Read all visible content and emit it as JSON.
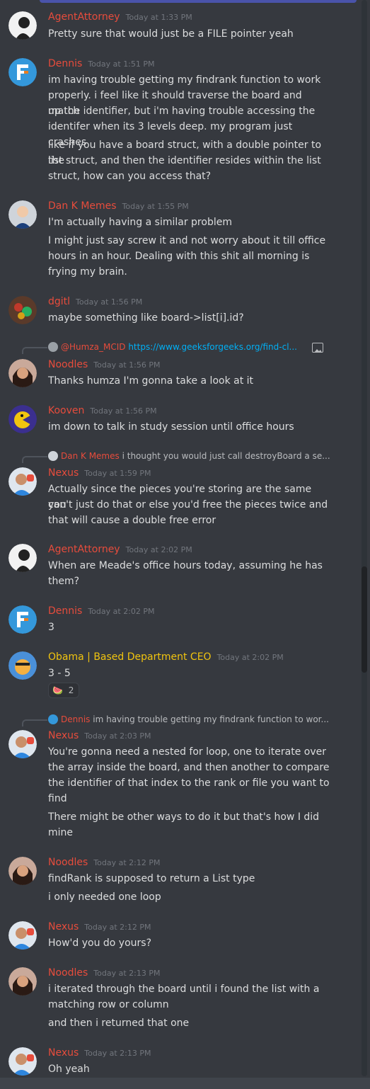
{
  "messages": [
    {
      "author": "AgentAttorney",
      "time": "Today at 1:33 PM",
      "lines": [
        "Pretty sure that would just be a FILE pointer yeah"
      ]
    },
    {
      "author": "Dennis",
      "time": "Today at 1:51 PM",
      "lines": [
        "im having trouble getting my findrank function to work",
        "properly. i feel like it should traverse the board and match",
        "up the identifier, but i'm having trouble accessing the",
        "identifer when its 3 levels deep. my program just crashes",
        "like if you have a board struct, with a double pointer to the",
        "list struct, and then the identifier resides within the list",
        "struct, how can you access that?"
      ]
    },
    {
      "author": "Dan K Memes",
      "time": "Today at 1:55 PM",
      "lines": [
        "I'm actually having a similar problem",
        "I might just say screw it and not worry about it till office",
        "hours in an hour. Dealing with this shit all morning is",
        "frying my brain."
      ]
    },
    {
      "author": "dgitl",
      "time": "Today at 1:56 PM",
      "lines": [
        "maybe something like board->list[i].id?"
      ]
    },
    {
      "author": "Noodles",
      "time": "Today at 1:56 PM",
      "reply_author": "@Humza_MCID",
      "reply_text": "https://www.geeksforgeeks.org/find-cl...",
      "lines": [
        "Thanks humza I'm gonna take a look at it"
      ]
    },
    {
      "author": "Kooven",
      "time": "Today at 1:56 PM",
      "lines": [
        "im down to talk in study session until office hours"
      ]
    },
    {
      "author": "Nexus",
      "time": "Today at 1:59 PM",
      "reply_author": "Dan K Memes",
      "reply_text": "i thought you would just call destroyBoard a se...",
      "lines": [
        "Actually since the pieces you're storing are the same you",
        "can't just do that or else you'd free the pieces twice and",
        "that will cause a double free error"
      ]
    },
    {
      "author": "AgentAttorney",
      "time": "Today at 2:02 PM",
      "lines": [
        "When are Meade's office hours today, assuming he has",
        "them?"
      ]
    },
    {
      "author": "Dennis",
      "time": "Today at 2:02 PM",
      "lines": [
        "3"
      ]
    },
    {
      "author": "Obama | Based Department CEO",
      "time": "Today at 2:02 PM",
      "lines": [
        "3 - 5"
      ],
      "reaction_emoji": "🍉",
      "reaction_count": "2"
    },
    {
      "author": "Nexus",
      "time": "Today at 2:03 PM",
      "reply_author": "Dennis",
      "reply_text": "im having trouble getting my findrank function to wor...",
      "lines": [
        "You're gonna need a nested for loop, one to iterate over",
        "the array inside the board, and then another to compare",
        "the identifier of that index to the rank or file you want to",
        "find",
        "There might be other ways to do it but that's how I did",
        "mine"
      ]
    },
    {
      "author": "Noodles",
      "time": "Today at 2:12 PM",
      "lines": [
        "findRank is supposed to return a List type",
        "i only needed one loop"
      ]
    },
    {
      "author": "Nexus",
      "time": "Today at 2:12 PM",
      "lines": [
        "How'd you do yours?"
      ]
    },
    {
      "author": "Noodles",
      "time": "Today at 2:13 PM",
      "lines": [
        "i iterated through the board until i found the list with a",
        "matching row or column",
        "and then i returned that one"
      ]
    },
    {
      "author": "Nexus",
      "time": "Today at 2:13 PM",
      "lines": [
        "Oh yeah"
      ]
    }
  ],
  "colors": {
    "background": "#36393f",
    "red_role": "#e74c3c",
    "gold_role": "#f1c40f",
    "link": "#00aff4",
    "timestamp": "#72767d"
  }
}
